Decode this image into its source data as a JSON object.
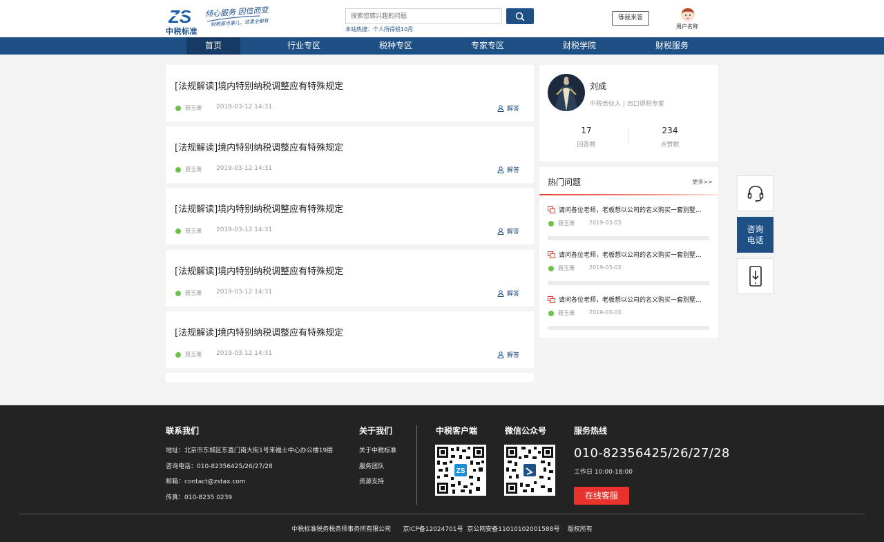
{
  "header": {
    "logo_mark": "ZS",
    "logo_name": "中税标准",
    "slogan_main": "倾心服务  因信而变",
    "slogan_sub": "财税那点事儿，这里全都有",
    "search_placeholder": "搜索您感兴趣的问题",
    "hot_search_prefix": "本站热搜：",
    "hot_search_term": "个人所得税10月",
    "wait_answer_label": "等我来答",
    "user_name": "用户名称"
  },
  "nav": {
    "items": [
      "首页",
      "行业专区",
      "税种专区",
      "专家专区",
      "财税学院",
      "财税服务"
    ],
    "active_index": 0
  },
  "questions": [
    {
      "title": "[法规解读]境内特别纳税调整应有特殊规定",
      "author": "聂玉珊",
      "date": "2019-03-12  14:31",
      "answer_label": "解答"
    },
    {
      "title": "[法规解读]境内特别纳税调整应有特殊规定",
      "author": "聂玉珊",
      "date": "2019-03-12  14:31",
      "answer_label": "解答"
    },
    {
      "title": "[法规解读]境内特别纳税调整应有特殊规定",
      "author": "聂玉珊",
      "date": "2019-03-12  14:31",
      "answer_label": "解答"
    },
    {
      "title": "[法规解读]境内特别纳税调整应有特殊规定",
      "author": "聂玉珊",
      "date": "2019-03-12  14:31",
      "answer_label": "解答"
    },
    {
      "title": "[法规解读]境内特别纳税调整应有特殊规定",
      "author": "聂玉珊",
      "date": "2019-03-12  14:31",
      "answer_label": "解答"
    }
  ],
  "expert": {
    "name": "刘成",
    "title": "中税合伙人 | 出口退税专家",
    "answers_count": "17",
    "answers_label": "回答数",
    "likes_count": "234",
    "likes_label": "点赞数"
  },
  "hot_questions": {
    "title": "热门问题",
    "more": "更多>>",
    "items": [
      {
        "text": "请问各位老师，老板想以公司的名义购买一套别墅...",
        "author": "聂玉珊",
        "date": "2019-03-03"
      },
      {
        "text": "请问各位老师，老板想以公司的名义购买一套别墅...",
        "author": "聂玉珊",
        "date": "2019-03-03"
      },
      {
        "text": "请问各位老师，老板想以公司的名义购买一套别墅...",
        "author": "聂玉珊",
        "date": "2019-03-03"
      }
    ]
  },
  "side_float": {
    "consult_line1": "咨询",
    "consult_line2": "电话"
  },
  "footer": {
    "contact_title": "联系我们",
    "address": "地址：北京市东城区东直门南大街1号来福士中心办公楼19层",
    "phone": "咨询电话：010-82356425/26/27/28",
    "email": "邮箱：contact@zstax.com",
    "fax": "传真：010-8235 0239",
    "about_title": "关于我们",
    "about_items": [
      "关于中税标准",
      "服务团队",
      "资源支持"
    ],
    "client_title": "中税客户端",
    "wechat_title": "微信公众号",
    "hotline_title": "服务热线",
    "hotline_number": "010-82356425/26/27/28",
    "work_hours": "工作日  10:00-18:00",
    "online_service": "在线客服",
    "copyright": "中税标准税务税务师事务所有限公司      京ICP备12024701号  京公网安备11010102001588号    版权所有"
  },
  "colors": {
    "brand_blue": "#1e4f85",
    "nav_active": "#153a63",
    "accent_red": "#e8322c",
    "author_green": "#6cc24a",
    "footer_bg": "#232323"
  }
}
